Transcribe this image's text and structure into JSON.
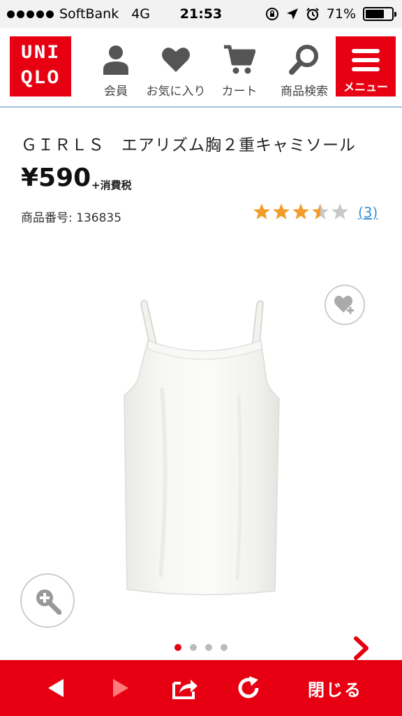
{
  "status_bar": {
    "carrier": "SoftBank",
    "network": "4G",
    "time": "21:53",
    "battery_percent": "71%",
    "battery_level": 0.71
  },
  "header": {
    "logo_line1": "UNI",
    "logo_line2": "QLO",
    "nav": [
      {
        "label": "会員",
        "icon": "person-icon"
      },
      {
        "label": "お気に入り",
        "icon": "heart-icon"
      },
      {
        "label": "カート",
        "icon": "cart-icon"
      },
      {
        "label": "商品検索",
        "icon": "search-icon"
      }
    ],
    "menu_label": "メニュー"
  },
  "product": {
    "title": "ＧＩＲＬＳ　エアリズム胸２重キャミソール",
    "price": "¥590",
    "tax_note": "+消費税",
    "product_number": "商品番号: 136835",
    "rating": 3.5,
    "rating_max": 5,
    "review_count": "(3)"
  },
  "gallery": {
    "image_count": 4,
    "active_index": 0
  },
  "toolbar": {
    "close_label": "閉じる"
  },
  "colors": {
    "brand_red": "#e60012",
    "star_orange": "#f39c2b",
    "link_blue": "#3a8fd4"
  }
}
